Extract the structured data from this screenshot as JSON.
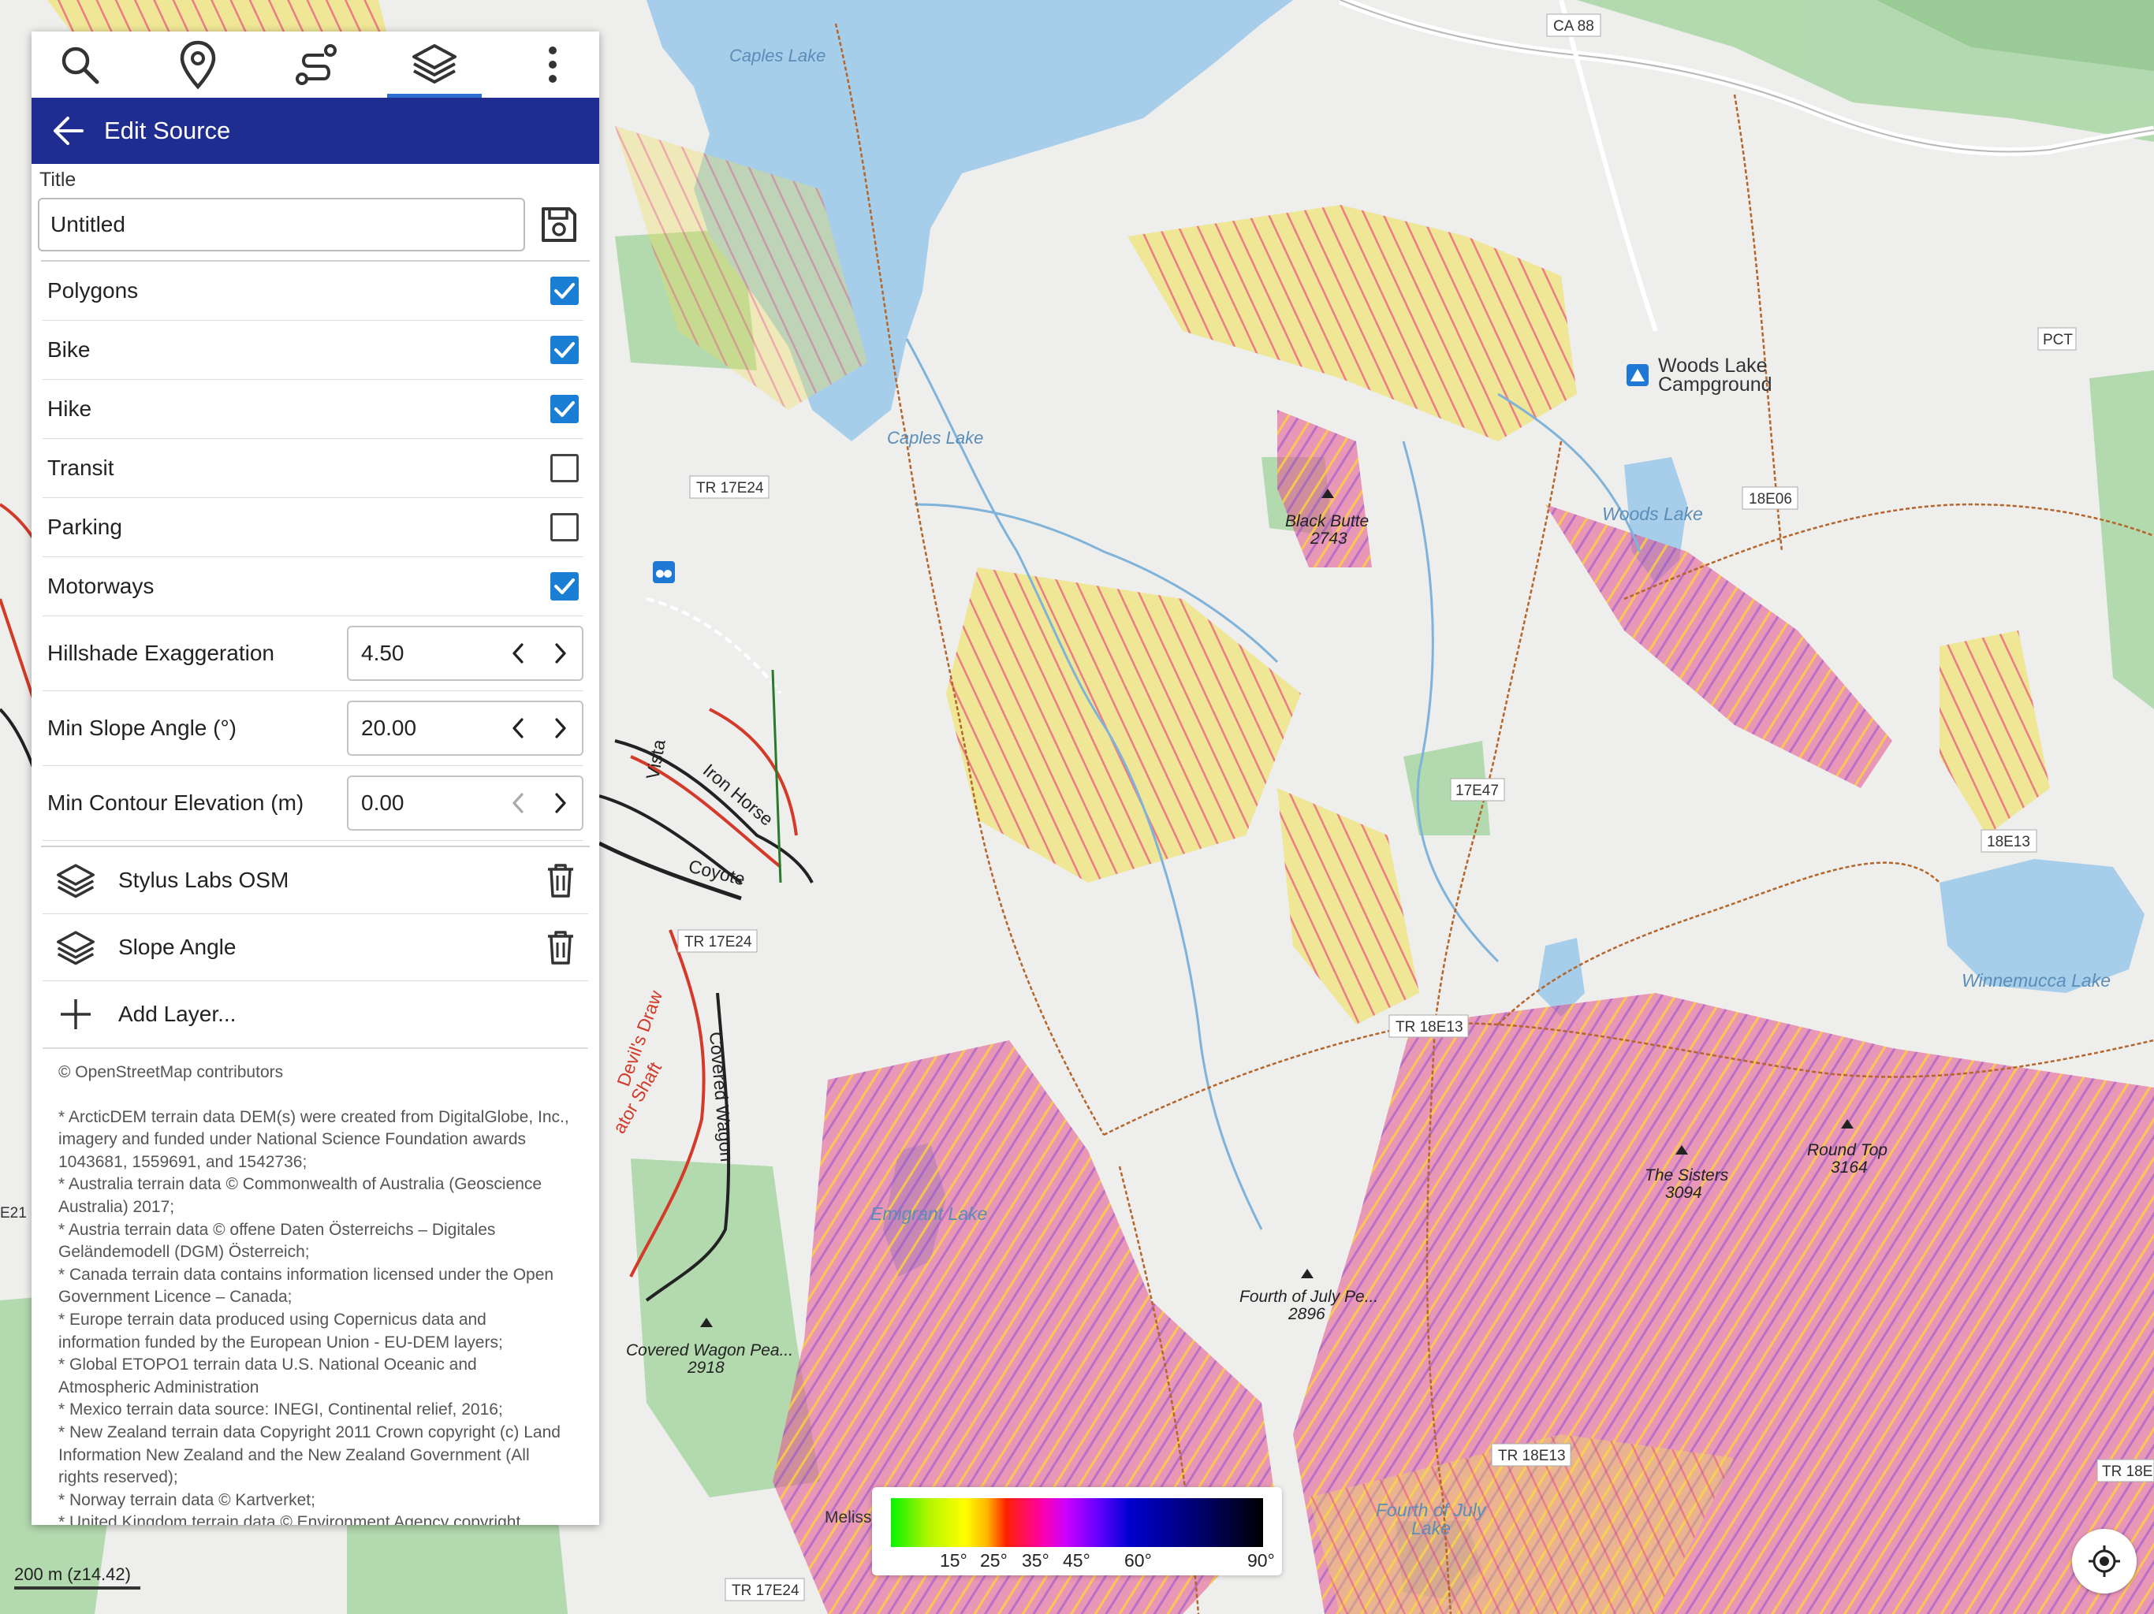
{
  "toolbar": {
    "tabs": [
      {
        "icon": "search-icon"
      },
      {
        "icon": "place-icon"
      },
      {
        "icon": "route-icon"
      },
      {
        "icon": "layers-icon",
        "active": true
      },
      {
        "icon": "more-vert-icon"
      }
    ]
  },
  "panel": {
    "header_title": "Edit Source",
    "title_label": "Title",
    "title_value": "Untitled",
    "toggles": [
      {
        "label": "Polygons",
        "checked": true
      },
      {
        "label": "Bike",
        "checked": true
      },
      {
        "label": "Hike",
        "checked": true
      },
      {
        "label": "Transit",
        "checked": false
      },
      {
        "label": "Parking",
        "checked": false
      },
      {
        "label": "Motorways",
        "checked": true
      }
    ],
    "spinners": [
      {
        "label": "Hillshade Exaggeration",
        "value": "4.50"
      },
      {
        "label": "Min Slope Angle (°)",
        "value": "20.00"
      },
      {
        "label": "Min Contour Elevation (m)",
        "value": "0.00"
      }
    ],
    "layers": [
      {
        "label": "Stylus Labs OSM"
      },
      {
        "label": "Slope Angle"
      }
    ],
    "add_layer": "Add Layer...",
    "attribution": [
      "© OpenStreetMap contributors",
      "",
      "* ArcticDEM terrain data DEM(s) were created from DigitalGlobe, Inc., imagery and funded under National Science Foundation awards 1043681, 1559691, and 1542736;",
      "* Australia terrain data © Commonwealth of Australia (Geoscience Australia) 2017;",
      "* Austria terrain data © offene Daten Österreichs – Digitales Geländemodell (DGM) Österreich;",
      "* Canada terrain data contains information licensed under the Open Government Licence – Canada;",
      "* Europe terrain data produced using Copernicus data and information funded by the European Union - EU-DEM layers;",
      "* Global ETOPO1 terrain data U.S. National Oceanic and Atmospheric Administration",
      "* Mexico terrain data source: INEGI, Continental relief, 2016;",
      "* New Zealand terrain data Copyright 2011 Crown copyright (c) Land Information New Zealand and the New Zealand Government (All rights reserved);",
      "* Norway terrain data © Kartverket;",
      "* United Kingdom terrain data © Environment Agency copyright"
    ]
  },
  "map": {
    "scale": "200 m  (z14.42)",
    "legend_ticks": [
      "15°",
      "25°",
      "35°",
      "45°",
      "60°",
      "90°"
    ],
    "labels": {
      "caples_lake_top": "Caples Lake",
      "caples_lake": "Caples Lake",
      "ca88": "CA 88",
      "pct": "PCT",
      "woods_campground_1": "Woods Lake",
      "woods_campground_2": "Campground",
      "woods_lake": "Woods Lake",
      "r18e06": "18E06",
      "tr17e24_a": "TR 17E24",
      "tr17e24_b": "TR 17E24",
      "tr17e24_c": "TR 17E24",
      "black_butte": "Black Butte",
      "black_butte_el": "2743",
      "r17e47": "17E47",
      "r18e13": "18E13",
      "tr18e13_a": "TR 18E13",
      "tr18e13_b": "TR 18E13",
      "tr18e_right": "TR 18E",
      "winnemucca": "Winnemucca Lake",
      "sisters": "The Sisters",
      "sisters_el": "3094",
      "round_top": "Round Top",
      "round_top_el": "3164",
      "fourth_peak": "Fourth of July Pe...",
      "fourth_peak_el": "2896",
      "emigrant": "Emigrant Lake",
      "covered_peak": "Covered Wagon Pea...",
      "covered_peak_el": "2918",
      "fourth_lake_1": "Fourth of July",
      "fourth_lake_2": "Lake",
      "melissa": "Meliss",
      "vista": "Vista",
      "iron_horse": "Iron Horse",
      "coyote": "Coyote",
      "covered_wagon": "Covered Wagon",
      "devils_draw": "Devil's Draw",
      "elevator_shaft": "ator Shaft",
      "e21": "E21"
    }
  },
  "colors": {
    "header_bg": "#1e2d8f",
    "checkbox_on": "#1a7fd4",
    "tab_active": "#2c6fd1",
    "water": "#a6cde9"
  }
}
